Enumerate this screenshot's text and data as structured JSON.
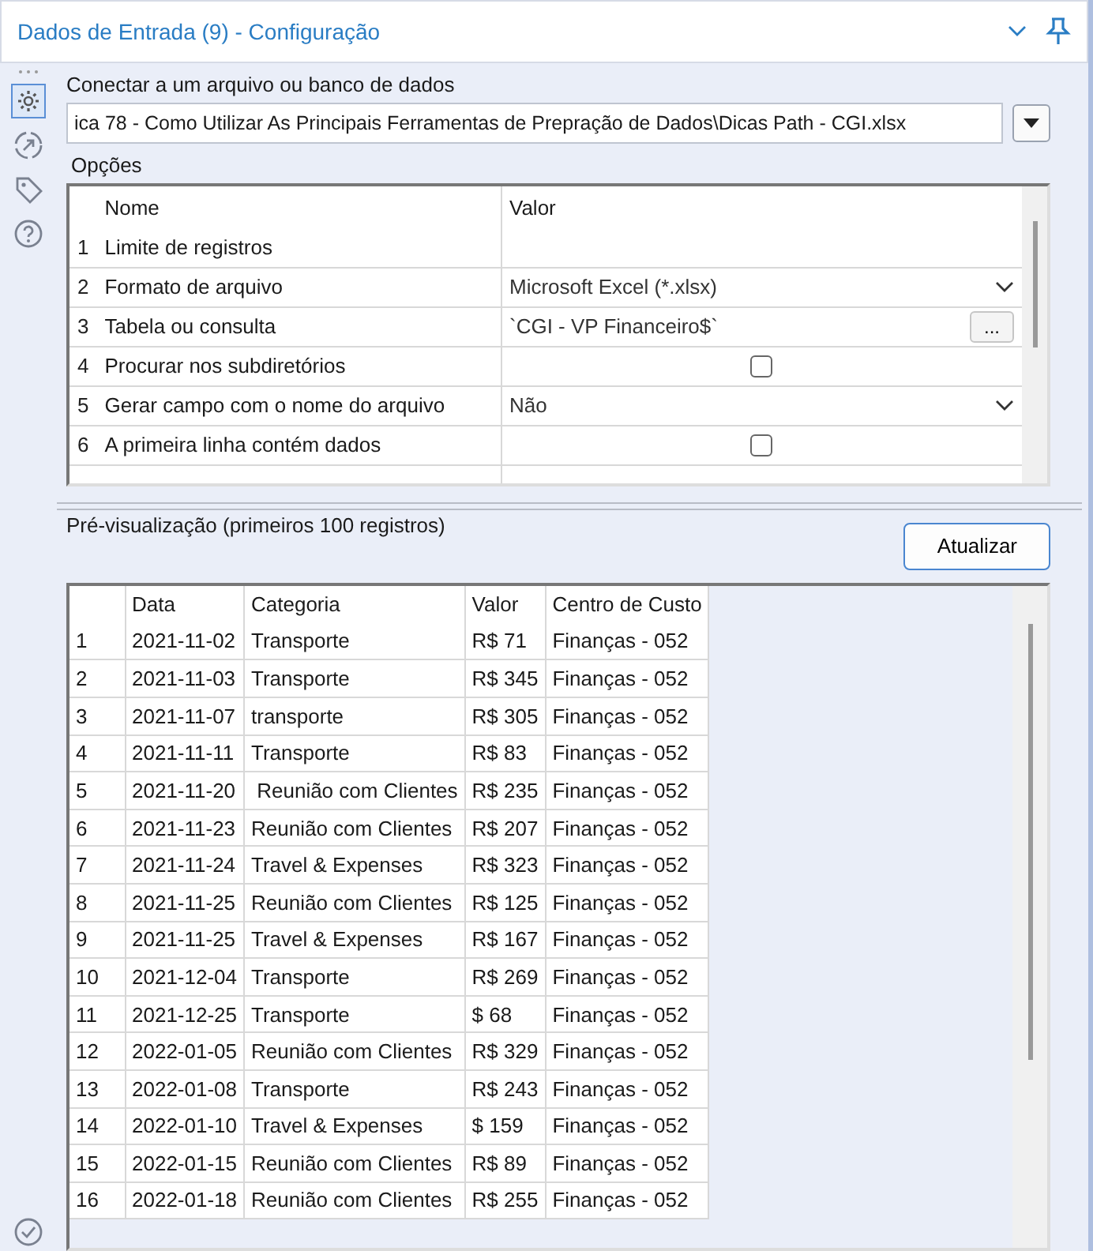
{
  "panel": {
    "title": "Dados de Entrada (9) - Configuração"
  },
  "connect": {
    "label": "Conectar a um arquivo ou banco de dados",
    "path": "ica 78 - Como Utilizar As Principais Ferramentas de Prepração de Dados\\Dicas Path - CGI.xlsx"
  },
  "options": {
    "title": "Opções",
    "columns": [
      "",
      "Nome",
      "Valor"
    ],
    "rows": [
      {
        "index": "1",
        "name": "Limite de registros",
        "kind": "text"
      },
      {
        "index": "2",
        "name": "Formato de arquivo",
        "kind": "dropdown",
        "value": "Microsoft Excel (*.xlsx)"
      },
      {
        "index": "3",
        "name": "Tabela ou consulta",
        "kind": "browse",
        "value": "`CGI - VP Financeiro$`",
        "button": "..."
      },
      {
        "index": "4",
        "name": "Procurar nos subdiretórios",
        "kind": "checkbox",
        "checked": false
      },
      {
        "index": "5",
        "name": "Gerar campo com o nome do arquivo",
        "kind": "dropdown",
        "value": "Não"
      },
      {
        "index": "6",
        "name": "A primeira linha contém dados",
        "kind": "checkbox",
        "checked": false
      }
    ]
  },
  "preview": {
    "title": "Pré-visualização (primeiros 100 registros)",
    "refresh_button": "Atualizar",
    "columns": [
      "",
      "Data",
      "Categoria",
      "Valor",
      "Centro de Custo"
    ],
    "rows": [
      [
        "1",
        "2021-11-02",
        "Transporte",
        "R$ 71",
        "Finanças - 052"
      ],
      [
        "2",
        "2021-11-03",
        "Transporte",
        "R$ 345",
        "Finanças - 052"
      ],
      [
        "3",
        "2021-11-07",
        "transporte",
        "R$ 305",
        "Finanças - 052"
      ],
      [
        "4",
        "2021-11-11",
        "Transporte",
        "R$ 83",
        "Finanças - 052"
      ],
      [
        "5",
        "2021-11-20",
        " Reunião com Clientes",
        "R$ 235",
        "Finanças - 052"
      ],
      [
        "6",
        "2021-11-23",
        "Reunião com Clientes",
        "R$ 207",
        "Finanças - 052"
      ],
      [
        "7",
        "2021-11-24",
        "Travel & Expenses",
        "R$ 323",
        "Finanças - 052"
      ],
      [
        "8",
        "2021-11-25",
        "Reunião com Clientes",
        "R$ 125",
        "Finanças - 052"
      ],
      [
        "9",
        "2021-11-25",
        "Travel & Expenses",
        "R$ 167",
        "Finanças - 052"
      ],
      [
        "10",
        "2021-12-04",
        "Transporte",
        "R$ 269",
        "Finanças - 052"
      ],
      [
        "11",
        "2021-12-25",
        "Transporte",
        "$ 68",
        "Finanças - 052"
      ],
      [
        "12",
        "2022-01-05",
        "Reunião com Clientes",
        "R$ 329",
        "Finanças - 052"
      ],
      [
        "13",
        "2022-01-08",
        "Transporte",
        "R$ 243",
        "Finanças - 052"
      ],
      [
        "14",
        "2022-01-10",
        "Travel & Expenses",
        "$ 159",
        "Finanças - 052"
      ],
      [
        "15",
        "2022-01-15",
        "Reunião com Clientes",
        "R$ 89",
        "Finanças - 052"
      ],
      [
        "16",
        "2022-01-18",
        "Reunião com Clientes",
        "R$ 255",
        "Finanças - 052"
      ]
    ]
  }
}
